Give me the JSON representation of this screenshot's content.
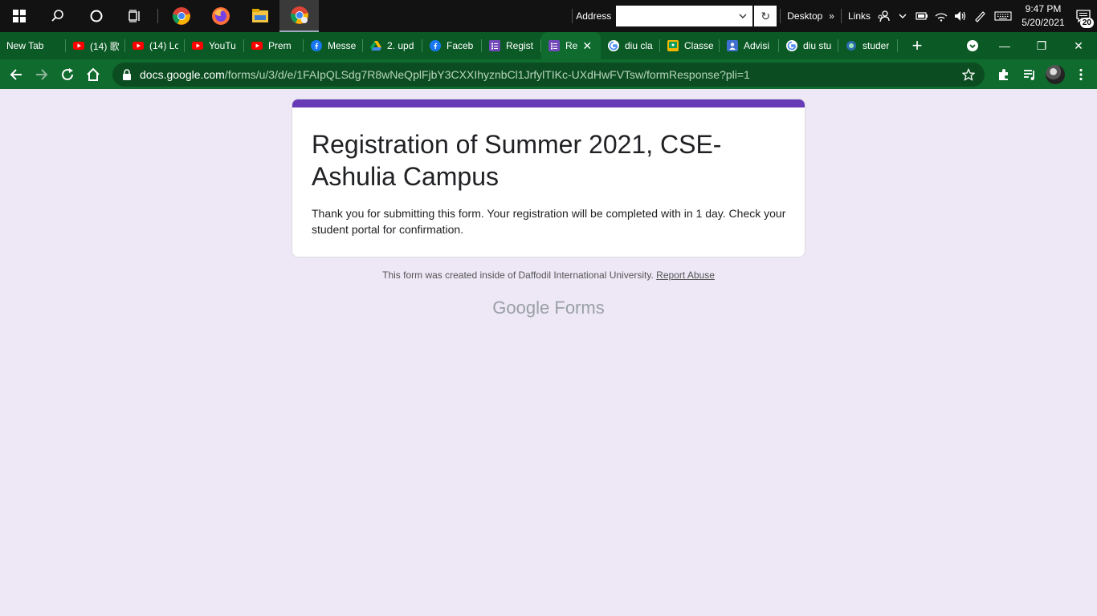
{
  "taskbar": {
    "address_label": "Address",
    "address_value": "",
    "desktop_label": "Desktop",
    "links_label": "Links",
    "clock_time": "9:47 PM",
    "clock_date": "5/20/2021",
    "notification_count": "20",
    "pinned_apps": [
      "start-icon",
      "search-icon",
      "cortana-icon",
      "task-view-icon",
      "chrome-icon",
      "firefox-icon",
      "file-explorer-icon",
      "chrome-active-icon"
    ]
  },
  "tabs": [
    {
      "title": "New Tab",
      "icon": "none"
    },
    {
      "title": "(14) 歌",
      "icon": "youtube-icon"
    },
    {
      "title": "(14) Lo",
      "icon": "youtube-icon"
    },
    {
      "title": "YouTu",
      "icon": "youtube-icon"
    },
    {
      "title": "Prem",
      "icon": "youtube-icon"
    },
    {
      "title": "Messe",
      "icon": "facebook-icon"
    },
    {
      "title": "2. upd",
      "icon": "drive-icon"
    },
    {
      "title": "Faceb",
      "icon": "facebook-icon"
    },
    {
      "title": "Regist",
      "icon": "forms-icon"
    },
    {
      "title": "Re",
      "icon": "forms-icon",
      "active": true
    },
    {
      "title": "diu cla",
      "icon": "google-icon"
    },
    {
      "title": "Classe",
      "icon": "classroom-icon"
    },
    {
      "title": "Advisi",
      "icon": "contacts-icon"
    },
    {
      "title": "diu stu",
      "icon": "google-icon"
    },
    {
      "title": "studer",
      "icon": "diu-icon"
    }
  ],
  "toolbar": {
    "url_host": "docs.google.com",
    "url_path": "/forms/u/3/d/e/1FAIpQLSdg7R8wNeQplFjbY3CXXIhyznbCl1JrfylTIKc-UXdHwFVTsw/formResponse?pli=1"
  },
  "form": {
    "title": "Registration of Summer 2021, CSE-Ashulia Campus",
    "message": "Thank you for submitting this form. Your registration will be completed with in 1 day. Check your student portal for confirmation.",
    "footer_text": "This form was created inside of Daffodil International University.",
    "report_abuse": "Report Abuse",
    "brand_google": "Google",
    "brand_forms": "Forms"
  },
  "colors": {
    "form_accent": "#673ab7",
    "page_bg": "#ede7f6",
    "chrome_theme": "#0f6b2e"
  }
}
